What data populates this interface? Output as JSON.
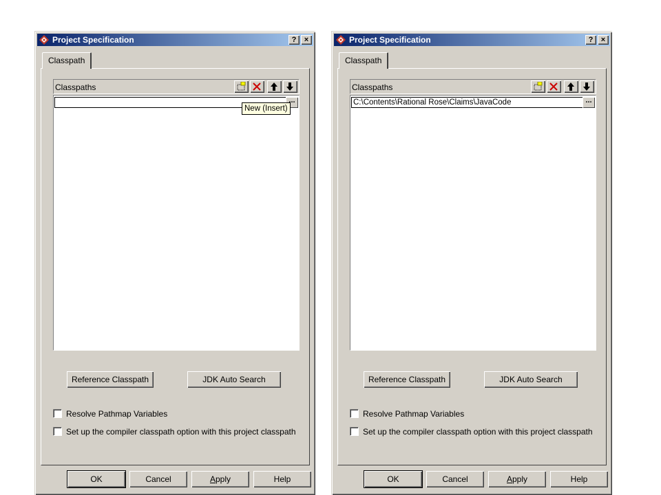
{
  "dialogs": [
    {
      "title": "Project Specification",
      "tab": "Classpath",
      "list_header": "Classpaths",
      "edit_value": "",
      "tooltip": "New (Insert)",
      "reference_button": "Reference Classpath",
      "jdk_button": "JDK Auto Search",
      "check1": "Resolve Pathmap Variables",
      "check2": "Set up the compiler classpath option  with this project classpath",
      "ok": "OK",
      "cancel": "Cancel",
      "apply_first": "A",
      "apply_rest": "pply",
      "help": "Help",
      "help_glyph": "?",
      "close_glyph": "×",
      "ellipsis": "..."
    },
    {
      "title": "Project Specification",
      "tab": "Classpath",
      "list_header": "Classpaths",
      "edit_value": "C:\\Contents\\Rational Rose\\Claims\\JavaCode",
      "reference_button": "Reference Classpath",
      "jdk_button": "JDK Auto Search",
      "check1": "Resolve Pathmap Variables",
      "check2": "Set up the compiler classpath option  with this project classpath",
      "ok": "OK",
      "cancel": "Cancel",
      "apply_first": "A",
      "apply_rest": "pply",
      "help": "Help",
      "help_glyph": "?",
      "close_glyph": "×",
      "ellipsis": "..."
    }
  ],
  "colors": {
    "titlebar_start": "#0a246a",
    "titlebar_end": "#a6caf0",
    "face": "#d4d0c8",
    "tooltip_bg": "#ffffe1",
    "delete_icon": "#cc0000"
  },
  "icons": [
    "app-icon",
    "new-item-icon",
    "delete-icon",
    "arrow-up-icon",
    "arrow-down-icon"
  ]
}
